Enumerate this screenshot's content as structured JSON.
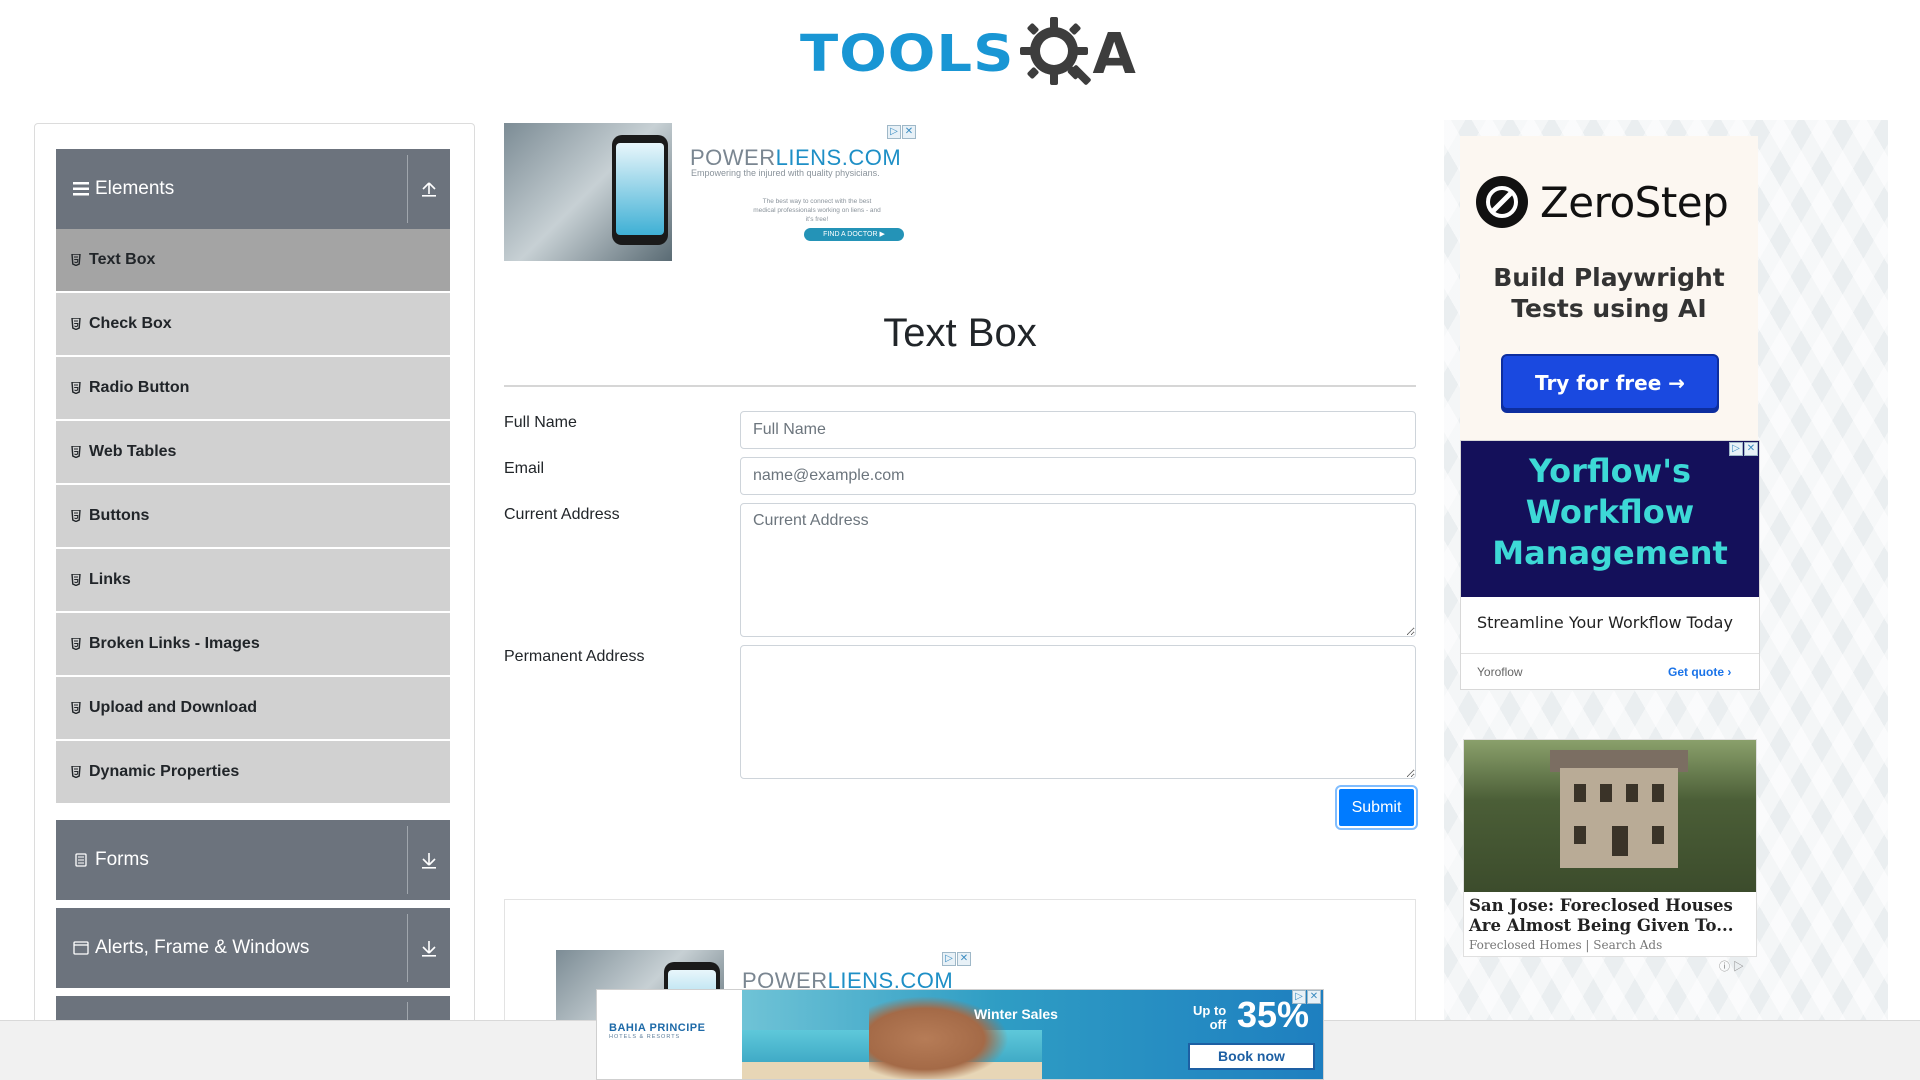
{
  "header": {
    "logo_tools": "TOOLS",
    "logo_q": "Q",
    "logo_a": "A"
  },
  "sidebar": {
    "groups": [
      {
        "title": "Elements",
        "icon": "list-icon",
        "state": "expanded"
      },
      {
        "title": "Forms",
        "icon": "document-icon",
        "state": "collapsed"
      },
      {
        "title": "Alerts, Frame & Windows",
        "icon": "window-icon",
        "state": "collapsed"
      }
    ],
    "items": [
      {
        "label": "Text Box",
        "active": true
      },
      {
        "label": "Check Box"
      },
      {
        "label": "Radio Button"
      },
      {
        "label": "Web Tables"
      },
      {
        "label": "Buttons"
      },
      {
        "label": "Links"
      },
      {
        "label": "Broken Links - Images"
      },
      {
        "label": "Upload and Download"
      },
      {
        "label": "Dynamic Properties"
      }
    ]
  },
  "top_ad": {
    "brand_a": "POWER",
    "brand_b": "LIENS.COM",
    "tagline": "Empowering the injured with quality physicians.",
    "small_text": "The best way to connect with the best medical professionals working on liens - and it's free!",
    "cta": "FIND A DOCTOR ▶",
    "photo_text": "POWERLIEN"
  },
  "form": {
    "title": "Text Box",
    "full_name_label": "Full Name",
    "full_name_placeholder": "Full Name",
    "email_label": "Email",
    "email_placeholder": "name@example.com",
    "current_address_label": "Current Address",
    "current_address_placeholder": "Current Address",
    "permanent_address_label": "Permanent Address",
    "submit_label": "Submit"
  },
  "right_ads": {
    "zerostep": {
      "name": "ZeroStep",
      "headline_1": "Build Playwright",
      "headline_2": "Tests using AI",
      "cta": "Try for free →"
    },
    "yorflow": {
      "headline_1": "Yorflow's",
      "headline_2": "Workflow",
      "headline_3": "Management",
      "subline": "Streamline Your Workflow Today",
      "brand": "Yoroflow",
      "cta": "Get quote ›"
    },
    "house": {
      "title": "San Jose: Foreclosed Houses Are Almost Being Given To...",
      "source": "Foreclosed Homes | Search Ads"
    }
  },
  "bottom_ad": {
    "logo": "BAHIA PRINCIPE",
    "logo_sub": "HOTELS & RESORTS",
    "headline": "Winter Sales",
    "upto_1": "Up to",
    "upto_2": "off",
    "percent": "35%",
    "cta": "Book now"
  },
  "colors": {
    "group_header": "#6c737d",
    "item_bg": "#d1d1d1",
    "item_active": "#a4a4a4",
    "primary": "#007bff",
    "logo_blue": "#1996d4"
  }
}
